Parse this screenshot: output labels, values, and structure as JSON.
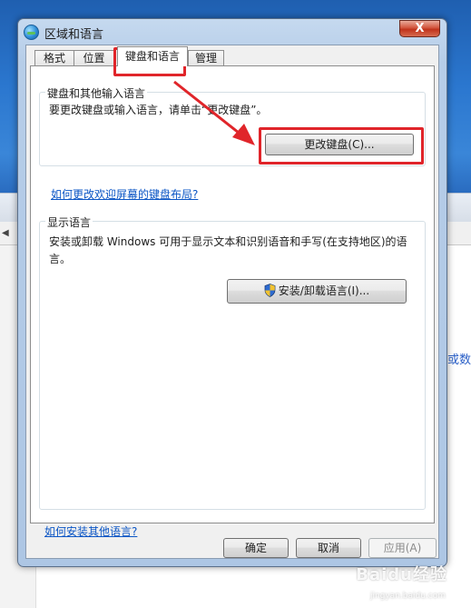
{
  "background": {
    "partial_link_text": "阻或数"
  },
  "window": {
    "title": "区域和语言",
    "close_label": "X",
    "icon": "globe-icon"
  },
  "tabs": [
    {
      "label": "格式",
      "active": false
    },
    {
      "label": "位置",
      "active": false
    },
    {
      "label": "键盘和语言",
      "active": true
    },
    {
      "label": "管理",
      "active": false
    }
  ],
  "keyboard_group": {
    "label": "键盘和其他输入语言",
    "description": "要更改键盘或输入语言，请单击“更改键盘”。",
    "button_label": "更改键盘(C)...",
    "help_link": "如何更改欢迎屏幕的键盘布局?"
  },
  "display_group": {
    "label": "显示语言",
    "description_line1": "安装或卸载 Windows 可用于显示文本和识别语音和手写(在支持地区)的语",
    "description_line2": "言。",
    "button_label": "安装/卸载语言(I)...",
    "button_icon": "uac-shield-icon"
  },
  "footer_link": "如何安装其他语言?",
  "dialog_buttons": {
    "ok": "确定",
    "cancel": "取消",
    "apply": "应用(A)"
  },
  "annotation": {
    "color": "#e0252a"
  },
  "watermark": {
    "text": "Baidu经验",
    "sub": "jingyan.baidu.com"
  }
}
